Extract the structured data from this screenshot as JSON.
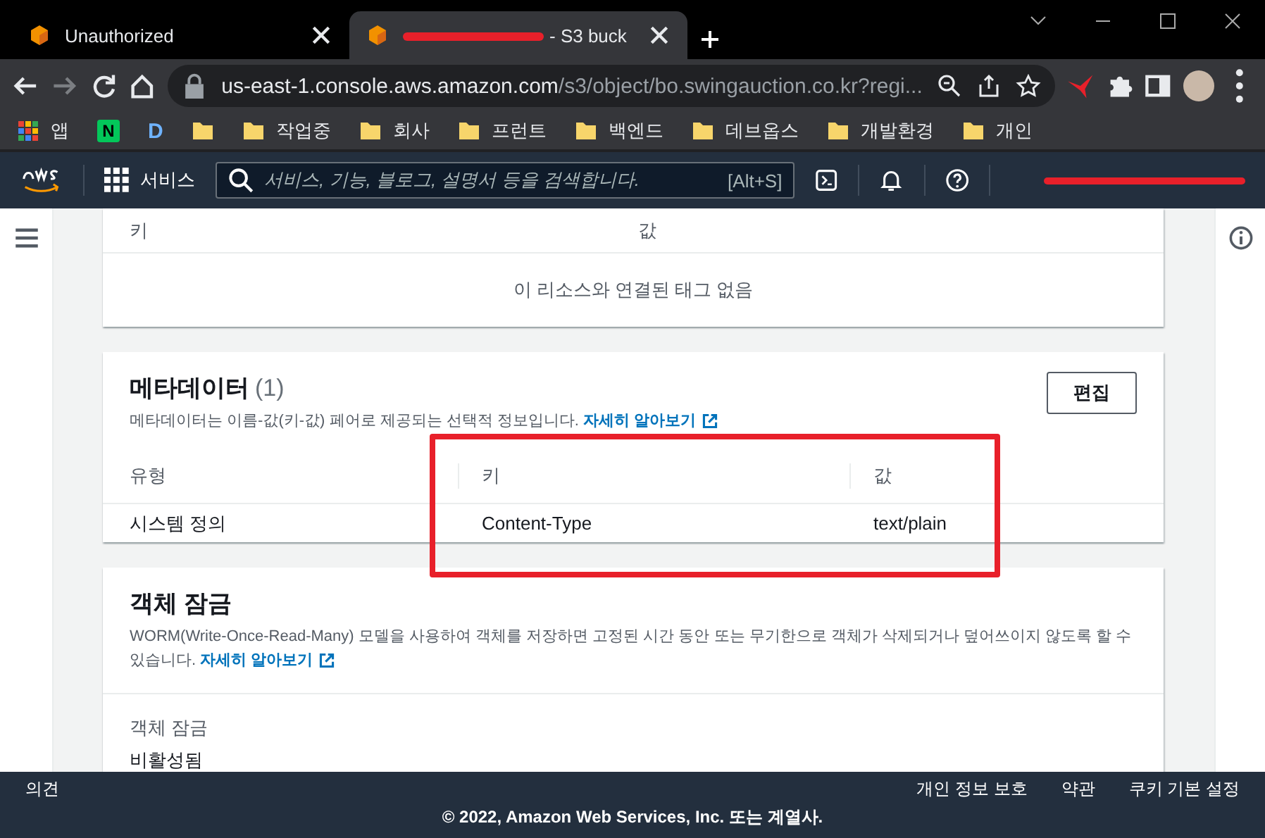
{
  "browser": {
    "tabs": [
      {
        "title": "Unauthorized",
        "selected": false,
        "redacted": false
      },
      {
        "title": "- S3 buck",
        "selected": true,
        "redacted": true
      }
    ],
    "address": {
      "host": "us-east-1.console.aws.amazon.com",
      "path": "/s3/object/bo.swingauction.co.kr?regi..."
    },
    "bookmarks": [
      {
        "kind": "apps",
        "label": "앱"
      },
      {
        "kind": "n",
        "label": "N"
      },
      {
        "kind": "d",
        "label": "D"
      },
      {
        "kind": "folder"
      },
      {
        "kind": "folder",
        "label": "작업중"
      },
      {
        "kind": "folder",
        "label": "회사"
      },
      {
        "kind": "folder",
        "label": "프런트"
      },
      {
        "kind": "folder",
        "label": "백엔드"
      },
      {
        "kind": "folder",
        "label": "데브옵스"
      },
      {
        "kind": "folder",
        "label": "개발환경"
      },
      {
        "kind": "folder",
        "label": "개인"
      }
    ]
  },
  "aws_nav": {
    "services": "서비스",
    "search_placeholder": "서비스, 기능, 블로그, 설명서 등을 검색합니다.",
    "shortcut": "[Alt+S]",
    "account_redacted": true
  },
  "tags": {
    "columns": [
      "키",
      "값"
    ],
    "empty_message": "이 리소스와 연결된 태그 없음"
  },
  "metadata": {
    "title": "메타데이터",
    "count": "(1)",
    "description": "메타데이터는 이름-값(키-값) 페어로 제공되는 선택적 정보입니다.",
    "learn_more": "자세히 알아보기",
    "edit_button": "편집",
    "columns": [
      "유형",
      "키",
      "값"
    ],
    "rows": [
      [
        "시스템 정의",
        "Content-Type",
        "text/plain"
      ]
    ]
  },
  "object_lock": {
    "title": "객체 잠금",
    "description": "WORM(Write-Once-Read-Many) 모델을 사용하여 객체를 저장하면 고정된 시간 동안 또는 무기한으로 객체가 삭제되거나 덮어쓰이지 않도록 할 수 있습니다.",
    "learn_more": "자세히 알아보기",
    "field_label": "객체 잠금",
    "field_value": "비활성됨"
  },
  "footer": {
    "feedback": "의견",
    "links": [
      "개인 정보 보호",
      "약관",
      "쿠키 기본 설정"
    ],
    "copyright": "© 2022, Amazon Web Services, Inc. 또는 계열사."
  }
}
